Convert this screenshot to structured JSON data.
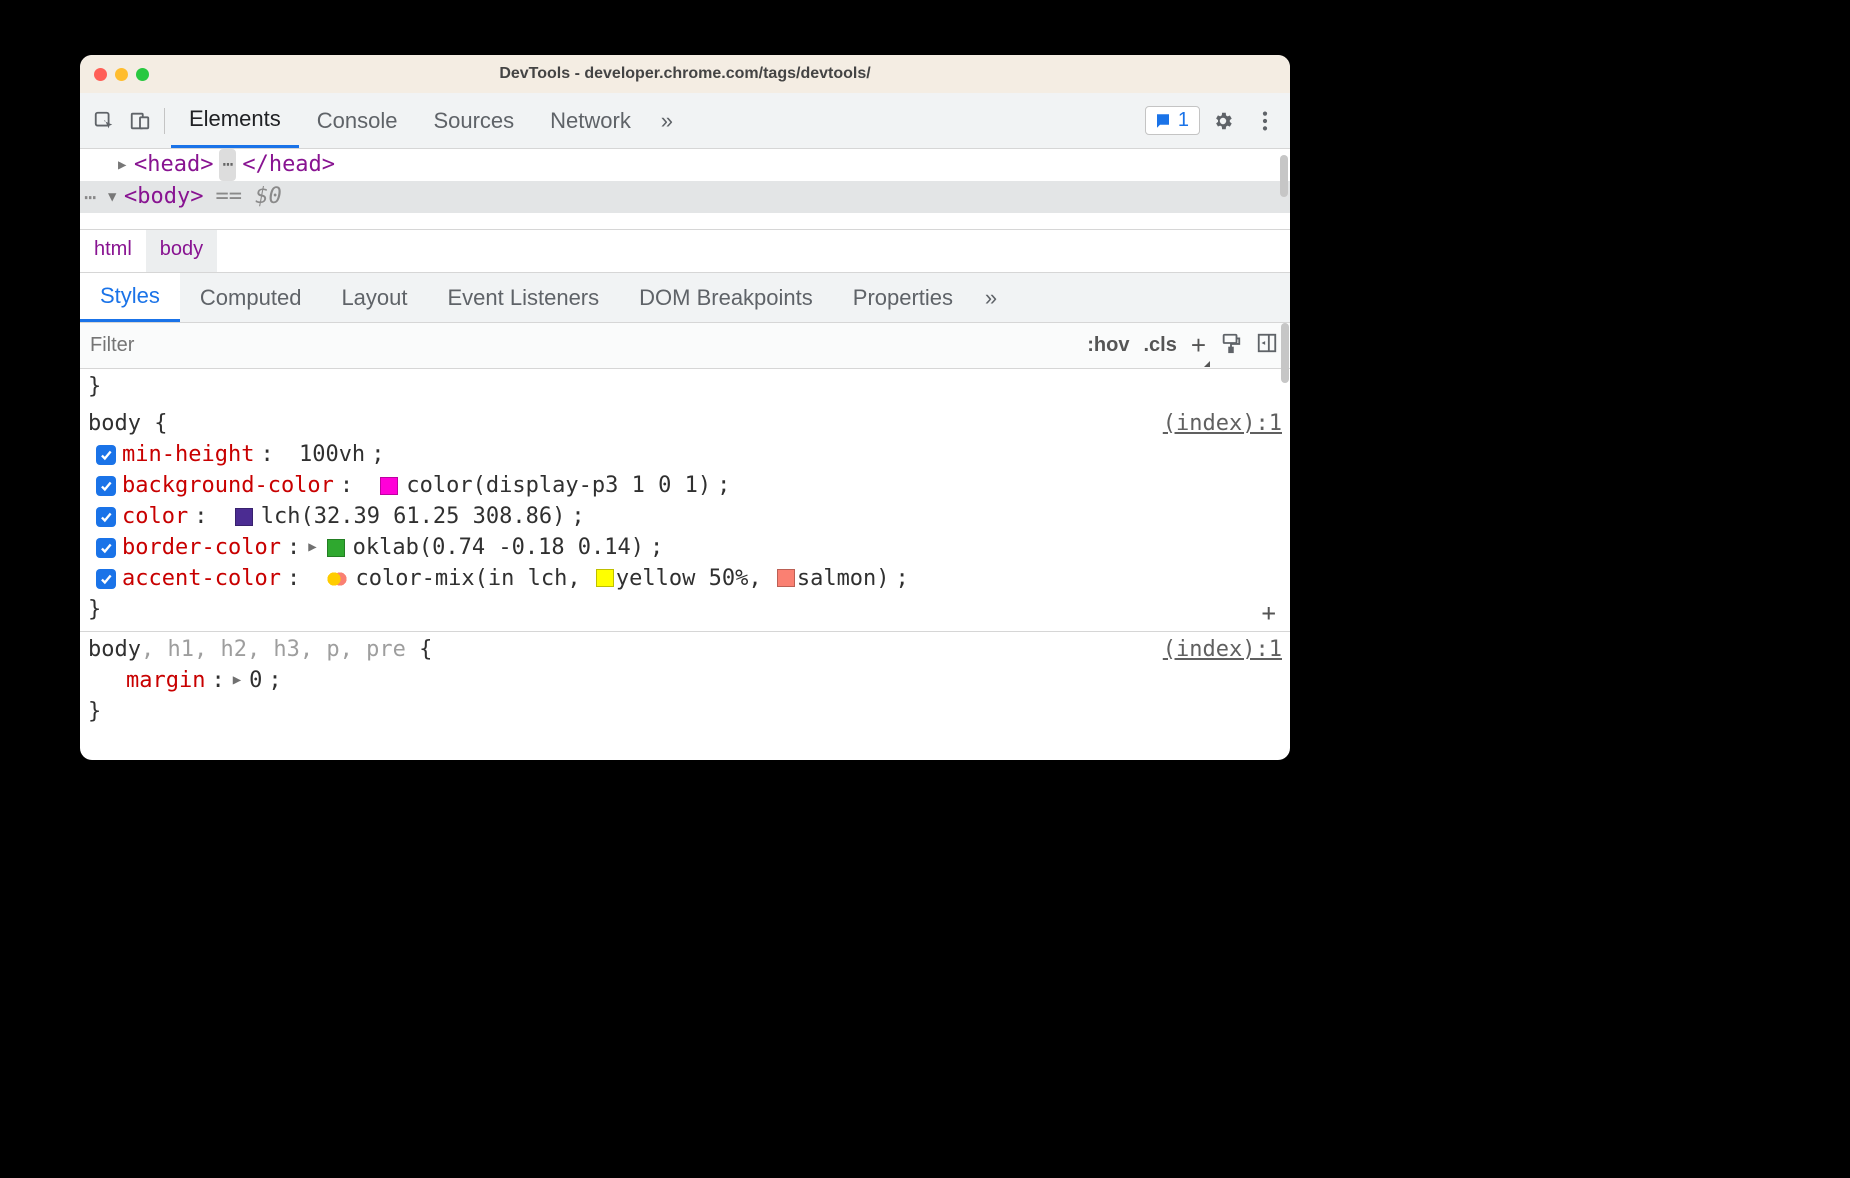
{
  "window": {
    "title": "DevTools - developer.chrome.com/tags/devtools/"
  },
  "toolbar": {
    "tabs": [
      "Elements",
      "Console",
      "Sources",
      "Network"
    ],
    "active_tab": "Elements",
    "overflow_glyph": "»",
    "issues_count": "1"
  },
  "dom": {
    "line1_open": "<head>",
    "line1_ellipsis": "⋯",
    "line1_close": "</head>",
    "selected_open": "<body>",
    "selected_marker": "== $0"
  },
  "breadcrumb": {
    "items": [
      "html",
      "body"
    ],
    "selected": "body"
  },
  "subtabs": {
    "items": [
      "Styles",
      "Computed",
      "Layout",
      "Event Listeners",
      "DOM Breakpoints",
      "Properties"
    ],
    "active": "Styles",
    "overflow_glyph": "»"
  },
  "filter": {
    "placeholder": "Filter",
    "hov": ":hov",
    "cls": ".cls"
  },
  "rules": [
    {
      "selector": "body",
      "source": "(index):1",
      "decls": [
        {
          "prop": "min-height",
          "val": "100vh"
        },
        {
          "prop": "background-color",
          "swatch": "#ff00d8",
          "val": "color(display-p3 1 0 1)"
        },
        {
          "prop": "color",
          "swatch": "#4b2c92",
          "val": "lch(32.39 61.25 308.86)"
        },
        {
          "prop": "border-color",
          "expand": true,
          "swatch": "#2fa82f",
          "val": "oklab(0.74 -0.18 0.14)"
        },
        {
          "prop": "accent-color",
          "mix": true,
          "val_pre": "color-mix(in lch, ",
          "swatch2": "#ffff00",
          "mid": "yellow 50%, ",
          "swatch3": "#fa8072",
          "val_post": "salmon)"
        }
      ]
    },
    {
      "selector_main": "body",
      "selector_dim": ", h1, h2, h3, p, pre",
      "source": "(index):1",
      "decls": [
        {
          "prop": "margin",
          "expand": true,
          "val": "0"
        }
      ]
    }
  ]
}
